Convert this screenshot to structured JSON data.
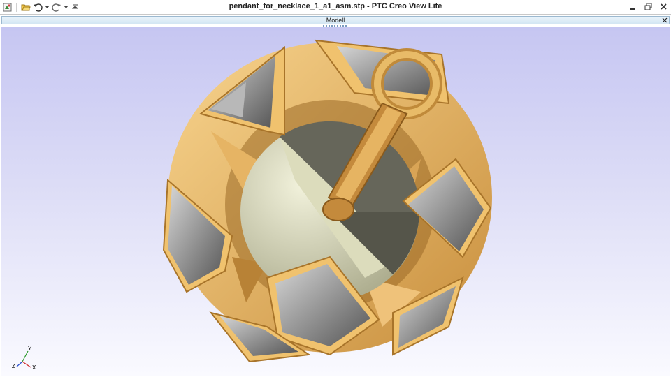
{
  "window": {
    "title": "pendant_for_necklace_1_a1_asm.stp - PTC Creo View Lite"
  },
  "quick_access_toolbar": {
    "items": [
      "app-icon",
      "open-icon",
      "undo-icon",
      "dropdown-icon",
      "redo-icon",
      "dropdown-icon",
      "customize-icon"
    ]
  },
  "window_controls": [
    "minimize-icon",
    "restore-icon",
    "close-icon"
  ],
  "panel": {
    "title": "Modell"
  },
  "view_triad": {
    "y_label": "Y",
    "z_label": "Z",
    "x_label": "X"
  },
  "colors": {
    "gold": "#e8b866",
    "gold_dark": "#a8742a",
    "gem_gray": "#8c8c8c",
    "sphere_light": "#dedec0",
    "sphere_dark": "#656555",
    "viewport_top": "#c6c6f2",
    "viewport_bottom": "#fafaff"
  }
}
